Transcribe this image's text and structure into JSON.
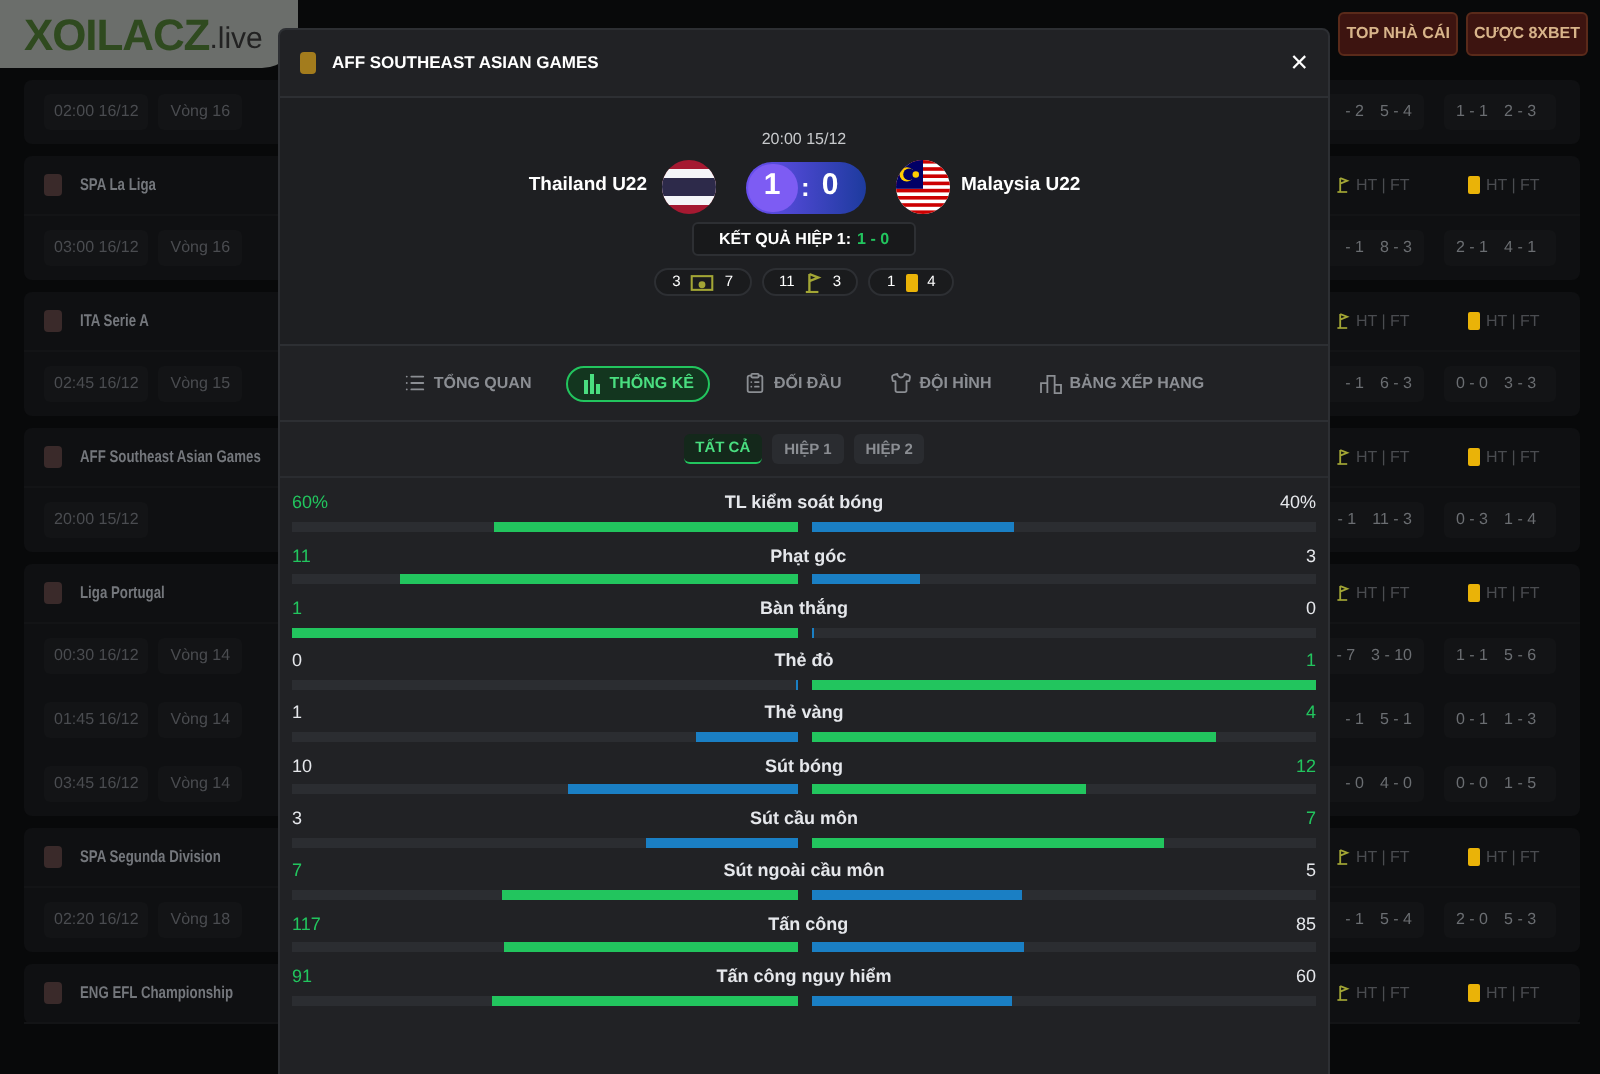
{
  "brand": {
    "logo_main": "XOILACZ",
    "logo_suffix": ".live"
  },
  "header_buttons": [
    "TOP NHÀ CÁI",
    "CƯỢC 8XBET"
  ],
  "leagues": [
    {
      "matches": [
        {
          "time": "02:00 16/12",
          "round": "Vòng 16",
          "scores": [
            "- 2",
            "5 - 4",
            "1 - 1",
            "2 - 3"
          ]
        }
      ]
    },
    {
      "name": "SPA La Liga",
      "header_cols": [
        "HT | FT",
        "HT | FT"
      ],
      "matches": [
        {
          "time": "03:00 16/12",
          "round": "Vòng 16",
          "scores": [
            "- 1",
            "8 - 3",
            "2 - 1",
            "4 - 1"
          ]
        }
      ]
    },
    {
      "name": "ITA Serie A",
      "header_cols": [
        "HT | FT",
        "HT | FT"
      ],
      "matches": [
        {
          "time": "02:45 16/12",
          "round": "Vòng 15",
          "scores": [
            "- 1",
            "6 - 3",
            "0 - 0",
            "3 - 3"
          ]
        }
      ]
    },
    {
      "name": "AFF Southeast Asian Games",
      "header_cols": [
        "HT | FT",
        "HT | FT"
      ],
      "matches": [
        {
          "time": "20:00 15/12",
          "scores": [
            "- 1",
            "11 - 3",
            "0 - 3",
            "1 - 4"
          ]
        }
      ]
    },
    {
      "name": "Liga Portugal",
      "header_cols": [
        "HT | FT",
        "HT | FT"
      ],
      "matches": [
        {
          "time": "00:30 16/12",
          "round": "Vòng 14",
          "scores": [
            "- 7",
            "3 - 10",
            "1 - 1",
            "5 - 6"
          ]
        },
        {
          "time": "01:45 16/12",
          "round": "Vòng 14",
          "scores": [
            "- 1",
            "5 - 1",
            "0 - 1",
            "1 - 3"
          ]
        },
        {
          "time": "03:45 16/12",
          "round": "Vòng 14",
          "scores": [
            "- 0",
            "4 - 0",
            "0 - 0",
            "1 - 5"
          ]
        }
      ]
    },
    {
      "name": "SPA Segunda Division",
      "header_cols": [
        "HT | FT",
        "HT | FT"
      ],
      "matches": [
        {
          "time": "02:20 16/12",
          "round": "Vòng 18",
          "scores": [
            "- 1",
            "5 - 4",
            "2 - 0",
            "5 - 3"
          ]
        }
      ]
    },
    {
      "name": "ENG EFL Championship",
      "header_cols": [
        "HT | FT",
        "HT | FT"
      ]
    }
  ],
  "modal": {
    "title": "AFF SOUTHEAST ASIAN GAMES",
    "close": "×",
    "match": {
      "time": "20:00 15/12",
      "home": "Thailand U22",
      "away": "Malaysia U22",
      "home_score": "1",
      "separator": ":",
      "away_score": "0",
      "halftime_label": "KẾT QUẢ HIỆP 1:",
      "halftime_score": "1 - 0"
    },
    "summary": [
      {
        "kind": "shots",
        "home": "3",
        "away": "7"
      },
      {
        "kind": "corners",
        "home": "11",
        "away": "3"
      },
      {
        "kind": "cards",
        "home": "1",
        "away": "4"
      }
    ],
    "tabs": [
      {
        "kind": "overview",
        "label": "TỔNG QUAN",
        "selected": false
      },
      {
        "kind": "stats",
        "label": "THỐNG KÊ",
        "selected": true
      },
      {
        "kind": "h2h",
        "label": "ĐỐI ĐẦU",
        "selected": false
      },
      {
        "kind": "lineup",
        "label": "ĐỘI HÌNH",
        "selected": false
      },
      {
        "kind": "standings",
        "label": "BẢNG XẾP HẠNG",
        "selected": false
      }
    ],
    "periods": [
      {
        "label": "TẤT CẢ",
        "selected": true
      },
      {
        "label": "HIỆP 1",
        "selected": false
      },
      {
        "label": "HIỆP 2",
        "selected": false
      }
    ],
    "stats": [
      {
        "label": "TL kiểm soát bóng",
        "home": {
          "value": "60%",
          "level": 0.6
        },
        "away": {
          "value": "40%",
          "level": 0.4
        }
      },
      {
        "label": "Phạt góc",
        "home": {
          "value": "11",
          "level": 0.786
        },
        "away": {
          "value": "3",
          "level": 0.214
        }
      },
      {
        "label": "Bàn thắng",
        "home": {
          "value": "1",
          "level": 1
        },
        "away": {
          "value": "0",
          "level": 0
        }
      },
      {
        "label": "Thẻ đỏ",
        "home": {
          "value": "0",
          "level": 0
        },
        "away": {
          "value": "1",
          "level": 1
        }
      },
      {
        "label": "Thẻ vàng",
        "home": {
          "value": "1",
          "level": 0.2
        },
        "away": {
          "value": "4",
          "level": 0.8
        }
      },
      {
        "label": "Sút bóng",
        "home": {
          "value": "10",
          "level": 0.455
        },
        "away": {
          "value": "12",
          "level": 0.545
        }
      },
      {
        "label": "Sút cầu môn",
        "home": {
          "value": "3",
          "level": 0.3
        },
        "away": {
          "value": "7",
          "level": 0.7
        }
      },
      {
        "label": "Sút ngoài cầu môn",
        "home": {
          "value": "7",
          "level": 0.583
        },
        "away": {
          "value": "5",
          "level": 0.417
        }
      },
      {
        "label": "Tấn công",
        "home": {
          "value": "117",
          "level": 0.579
        },
        "away": {
          "value": "85",
          "level": 0.421
        }
      },
      {
        "label": "Tấn công nguy hiểm",
        "home": {
          "value": "91",
          "level": 0.603
        },
        "away": {
          "value": "60",
          "level": 0.397
        }
      }
    ]
  }
}
